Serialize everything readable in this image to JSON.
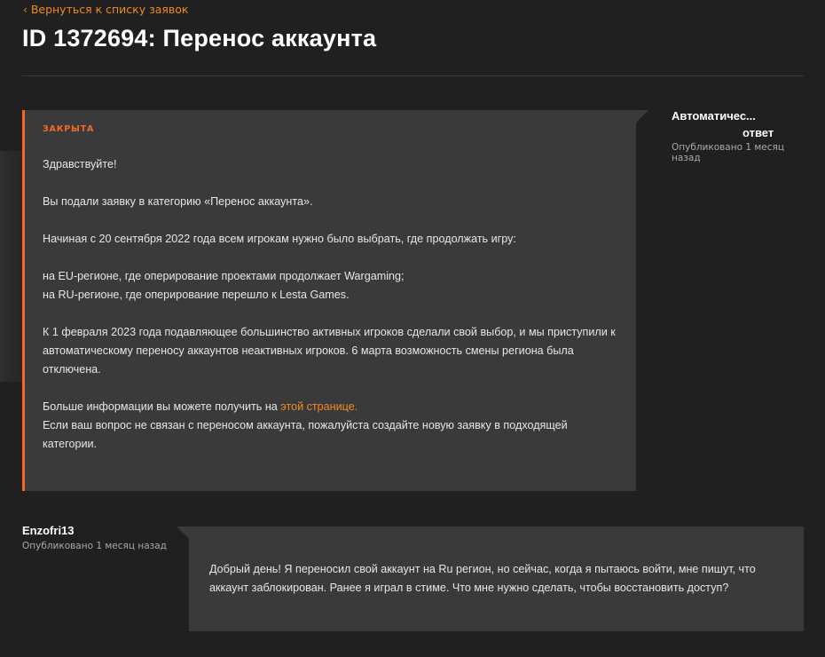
{
  "nav": {
    "back_label": "Вернуться к списку заявок",
    "back_icon": "chevron-left-icon"
  },
  "header": {
    "title": "ID 1372694: Перенос аккаунта"
  },
  "auto_reply": {
    "status": "ЗАКРЫТА",
    "author_line1": "Автоматичес...",
    "author_line2": "ответ",
    "published": "Опубликовано 1 месяц назад",
    "greeting": "Здравствуйте!",
    "p1": "Вы подали заявку в категорию «Перенос аккаунта».",
    "p2": "Начиная с 20 сентября 2022 года всем игрокам нужно было выбрать, где продолжать игру:",
    "p3_line1": "на EU-регионе, где оперирование проектами продолжает Wargaming;",
    "p3_line2": "на RU-регионе, где оперирование перешло к Lesta Games.",
    "p4": "К 1 февраля 2023 года подавляющее большинство активных игроков сделали свой выбор, и мы приступили к автоматическому переносу аккаунтов неактивных игроков. 6 марта возможность смены региона была отключена.",
    "p5_prefix": "Больше информации вы можете получить на ",
    "p5_link": "этой странице.",
    "p5_line2": "Если ваш вопрос не связан с переносом аккаунта, пожалуйста создайте новую заявку в подходящей категории."
  },
  "user_message": {
    "author": "Enzofri13",
    "published": "Опубликовано 1 месяц назад",
    "text": "Добрый день! Я переносил свой аккаунт на Ru регион, но сейчас, когда я пытаюсь войти, мне пишут, что аккаунт заблокирован. Ранее я играл в стиме. Что мне нужно сделать, чтобы восстановить доступ?"
  },
  "colors": {
    "accent": "#f26b21",
    "link": "#f08a1e",
    "card_bg": "#3a3a3c",
    "page_bg": "#202020"
  }
}
